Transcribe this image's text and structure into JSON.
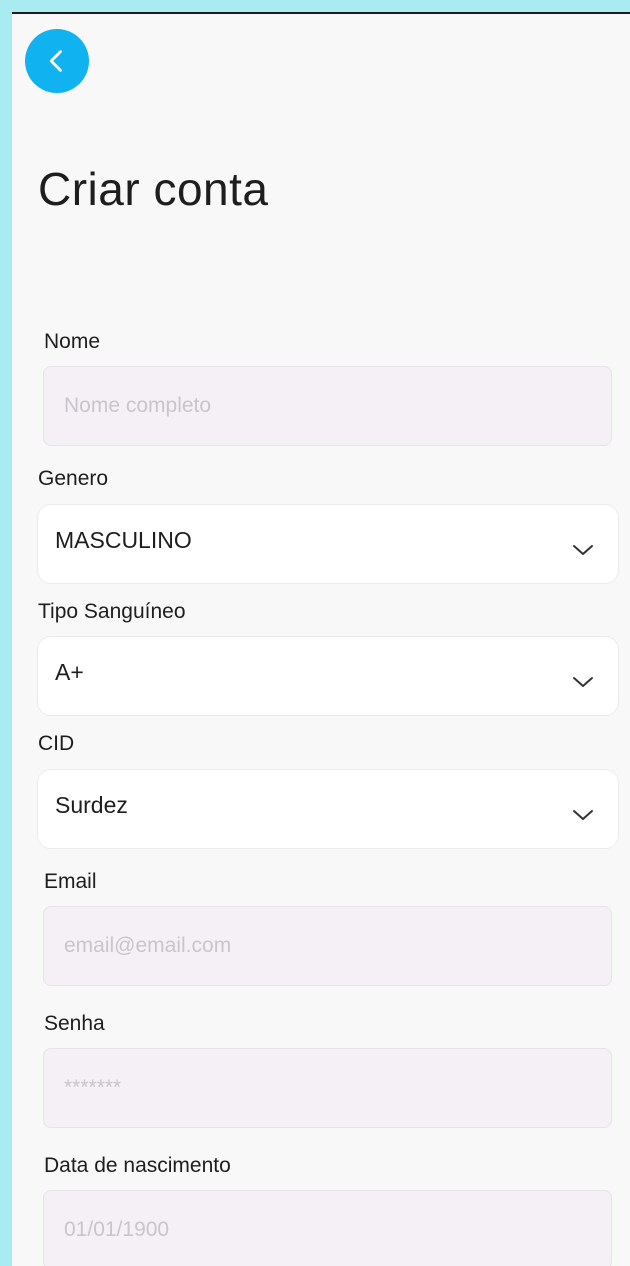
{
  "header": {
    "back_icon": "chevron-left-icon",
    "title": "Criar conta"
  },
  "form": {
    "name": {
      "label": "Nome",
      "placeholder": "Nome completo"
    },
    "gender": {
      "label": "Genero",
      "value": "MASCULINO"
    },
    "blood_type": {
      "label": "Tipo Sanguíneo",
      "value": "A+"
    },
    "cid": {
      "label": "CID",
      "value": "Surdez"
    },
    "email": {
      "label": "Email",
      "placeholder": "email@email.com"
    },
    "password": {
      "label": "Senha",
      "placeholder": "*******"
    },
    "birth_date": {
      "label": "Data de nascimento",
      "placeholder": "01/01/1900"
    }
  },
  "colors": {
    "accent": "#10b2ef",
    "background": "#f8f8f8",
    "outer": "#a8ecf2",
    "input_fill": "#f4f0f5"
  }
}
